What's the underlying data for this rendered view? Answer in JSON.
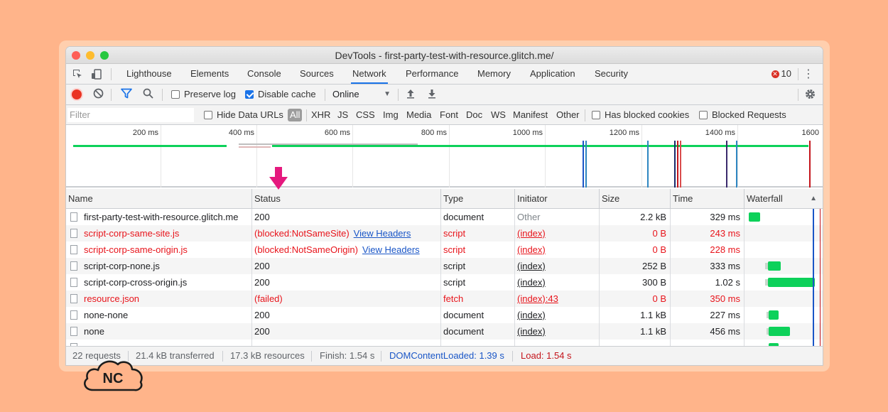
{
  "window": {
    "title": "DevTools - first-party-test-with-resource.glitch.me/"
  },
  "tabs": [
    "Lighthouse",
    "Elements",
    "Console",
    "Sources",
    "Network",
    "Performance",
    "Memory",
    "Application",
    "Security"
  ],
  "active_tab": "Network",
  "error_count": "10",
  "toolbar": {
    "preserve_log": "Preserve log",
    "disable_cache": "Disable cache",
    "throttling": "Online"
  },
  "filterbar": {
    "placeholder": "Filter",
    "hide_data_urls": "Hide Data URLs",
    "all": "All",
    "types": [
      "XHR",
      "JS",
      "CSS",
      "Img",
      "Media",
      "Font",
      "Doc",
      "WS",
      "Manifest",
      "Other"
    ],
    "blocked_cookies": "Has blocked cookies",
    "blocked_requests": "Blocked Requests"
  },
  "overview": {
    "ticks": [
      "200 ms",
      "400 ms",
      "600 ms",
      "800 ms",
      "1000 ms",
      "1200 ms",
      "1400 ms",
      "1600"
    ]
  },
  "columns": {
    "name": "Name",
    "status": "Status",
    "type": "Type",
    "initiator": "Initiator",
    "size": "Size",
    "time": "Time",
    "waterfall": "Waterfall"
  },
  "rows": [
    {
      "name": "first-party-test-with-resource.glitch.me",
      "status": "200",
      "link": "",
      "type": "document",
      "initiator": "Other",
      "size": "2.2 kB",
      "time": "329 ms",
      "error": false
    },
    {
      "name": "script-corp-same-site.js",
      "status": "(blocked:NotSameSite)",
      "link": "View Headers",
      "type": "script",
      "initiator": "(index)",
      "size": "0 B",
      "time": "243 ms",
      "error": true
    },
    {
      "name": "script-corp-same-origin.js",
      "status": "(blocked:NotSameOrigin)",
      "link": "View Headers",
      "type": "script",
      "initiator": "(index)",
      "size": "0 B",
      "time": "228 ms",
      "error": true
    },
    {
      "name": "script-corp-none.js",
      "status": "200",
      "link": "",
      "type": "script",
      "initiator": "(index)",
      "size": "252 B",
      "time": "333 ms",
      "error": false
    },
    {
      "name": "script-corp-cross-origin.js",
      "status": "200",
      "link": "",
      "type": "script",
      "initiator": "(index)",
      "size": "300 B",
      "time": "1.02 s",
      "error": false
    },
    {
      "name": "resource.json",
      "status": "(failed)",
      "link": "",
      "type": "fetch",
      "initiator": "(index):43",
      "size": "0 B",
      "time": "350 ms",
      "error": true
    },
    {
      "name": "none-none",
      "status": "200",
      "link": "",
      "type": "document",
      "initiator": "(index)",
      "size": "1.1 kB",
      "time": "227 ms",
      "error": false
    },
    {
      "name": "none",
      "status": "200",
      "link": "",
      "type": "document",
      "initiator": "(index)",
      "size": "1.1 kB",
      "time": "456 ms",
      "error": false
    }
  ],
  "statusbar": {
    "requests": "22 requests",
    "transferred": "21.4 kB transferred",
    "resources": "17.3 kB resources",
    "finish": "Finish: 1.54 s",
    "dom": "DOMContentLoaded: 1.39 s",
    "load": "Load: 1.54 s"
  },
  "colors": {
    "accent": "#1a73e8",
    "error": "#e8141b",
    "waterfall": "#0dd15a",
    "arrow": "#e5197e",
    "dom_line": "#1a56c7",
    "load_line": "#c4141b"
  },
  "logo": {
    "text": "NC"
  }
}
